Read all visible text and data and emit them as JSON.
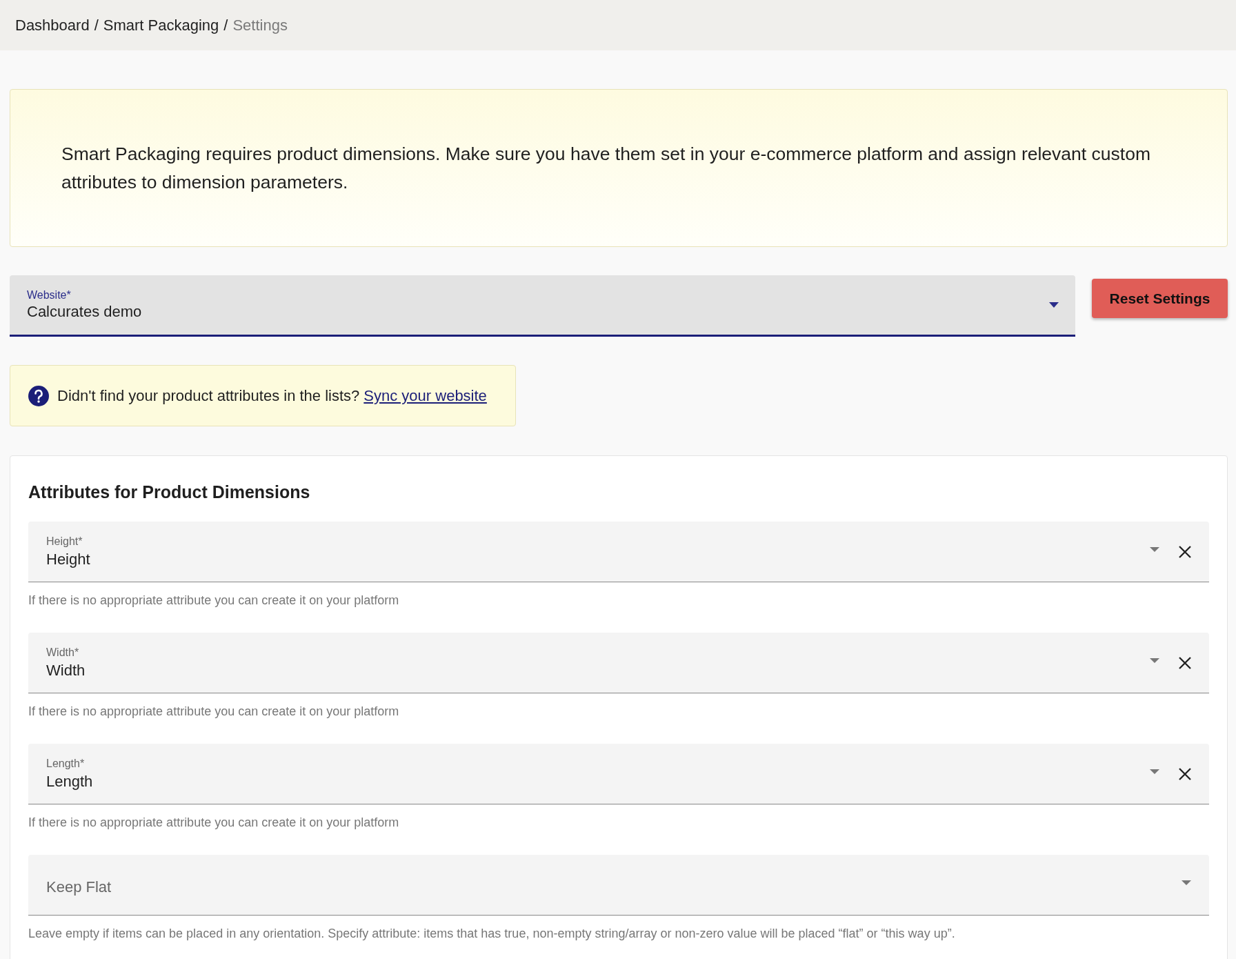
{
  "breadcrumb": [
    {
      "label": "Dashboard",
      "current": false
    },
    {
      "label": "Smart Packaging",
      "current": false
    },
    {
      "label": "Settings",
      "current": true
    }
  ],
  "breadcrumb_separator": "/",
  "notice": {
    "text": "Smart Packaging requires product dimensions. Make sure you have them set in your e-commerce platform and assign relevant custom attributes to dimension parameters."
  },
  "website": {
    "label": "Website*",
    "value": "Calcurates demo",
    "focused": true
  },
  "reset_button": "Reset Settings",
  "sync_hint": {
    "text": "Didn't find your product attributes in the lists?",
    "link": "Sync your website"
  },
  "attributes": {
    "title": "Attributes for Product Dimensions",
    "fields": [
      {
        "label": "Height*",
        "value": "Height",
        "clearable": true,
        "helper": "If there is no appropriate attribute you can create it on your platform"
      },
      {
        "label": "Width*",
        "value": "Width",
        "clearable": true,
        "helper": "If there is no appropriate attribute you can create it on your platform"
      },
      {
        "label": "Length*",
        "value": "Length",
        "clearable": true,
        "helper": "If there is no appropriate attribute you can create it on your platform"
      },
      {
        "placeholder": "Keep Flat",
        "clearable": false,
        "helper": "Leave empty if items can be placed in any orientation. Specify attribute: items that has true, non-empty string/array or non-zero value will be placed “flat” or “this way up”."
      }
    ]
  }
}
